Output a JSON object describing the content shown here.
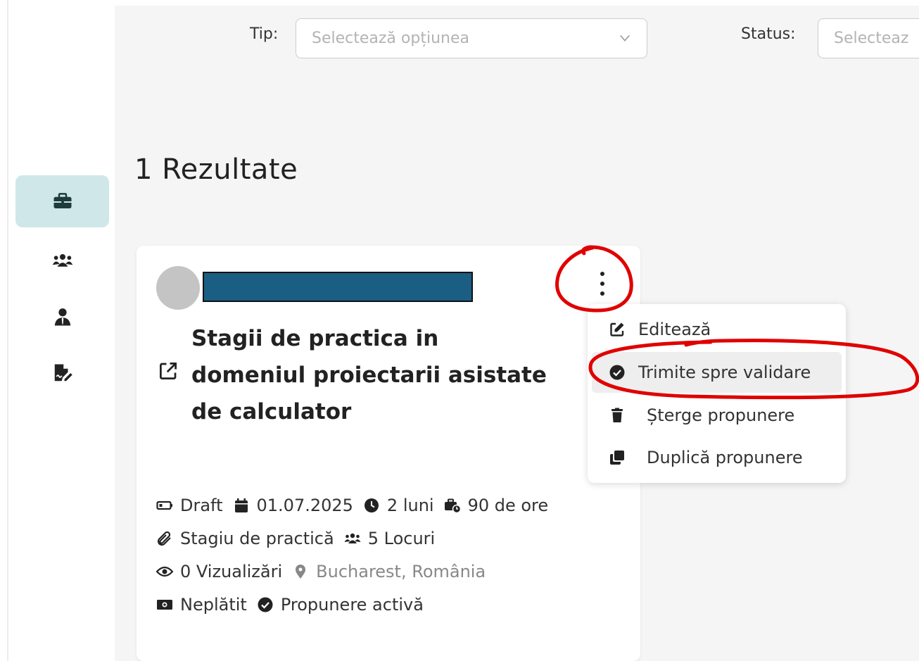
{
  "filters": {
    "tip_label": "Tip:",
    "tip_placeholder": "Selectează opțiunea",
    "status_label": "Status:",
    "status_placeholder": "Selecteaz"
  },
  "results": {
    "title": "1 Rezultate"
  },
  "card": {
    "title_line1": "Stagii de practica in",
    "title_line2": "domeniul proiectarii asistate",
    "title_line3": "de calculator",
    "status": "Draft",
    "date": "01.07.2025",
    "duration": "2 luni",
    "hours": "90 de ore",
    "type": "Stagiu de practică",
    "seats": "5 Locuri",
    "views": "0 Vizualizări",
    "location": "Bucharest, România",
    "payment": "Neplătit",
    "proposal_status": "Propunere activă"
  },
  "menu": {
    "items": [
      {
        "label": "Editează",
        "icon": "edit-icon"
      },
      {
        "label": "Trimite spre validare",
        "icon": "check-circle-icon"
      },
      {
        "label": "Șterge propunere",
        "icon": "trash-icon"
      },
      {
        "label": "Duplică propunere",
        "icon": "duplicate-icon"
      }
    ]
  },
  "colors": {
    "sidebar_active": "#cfe7e8",
    "redaction": "#1a5e83",
    "annotation": "#e00000"
  }
}
